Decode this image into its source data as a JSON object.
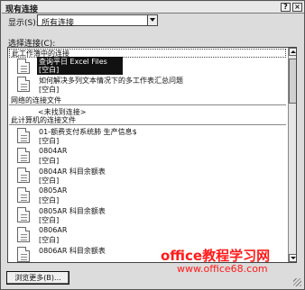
{
  "window": {
    "title": "现有连接",
    "help_label": "?",
    "close_label": "×"
  },
  "show": {
    "label": "显示(S):",
    "selected": "所有连接"
  },
  "select_label": "选择连接(C):",
  "groups": [
    {
      "label": "此工作簿中的连接"
    },
    {
      "label": "网络的连接文件"
    },
    {
      "label": "此计算机的连接文件"
    }
  ],
  "items": [
    {
      "name": "查询平日 Excel Files",
      "desc": "[空白]"
    },
    {
      "name": "如何解决多列文本情况下的多工作表汇总问题",
      "desc": "[空白]"
    },
    {
      "name": "01-额费支付系统肺 生产信息$",
      "desc": "[空白]"
    },
    {
      "name": "0804AR",
      "desc": "[空白]"
    },
    {
      "name": "0804AR 科目余额表",
      "desc": "[空白]"
    },
    {
      "name": "0805AR",
      "desc": "[空白]"
    },
    {
      "name": "0805AR 科目余额表",
      "desc": "[空白]"
    },
    {
      "name": "0806AR",
      "desc": "[空白]"
    },
    {
      "name": "0806AR 科目余额表",
      "desc": ""
    }
  ],
  "not_found": "<未找到连接>",
  "browse_label": "浏览更多(B)...",
  "watermark": {
    "line1": "office教程学习网",
    "line2": "www.office68.com"
  }
}
